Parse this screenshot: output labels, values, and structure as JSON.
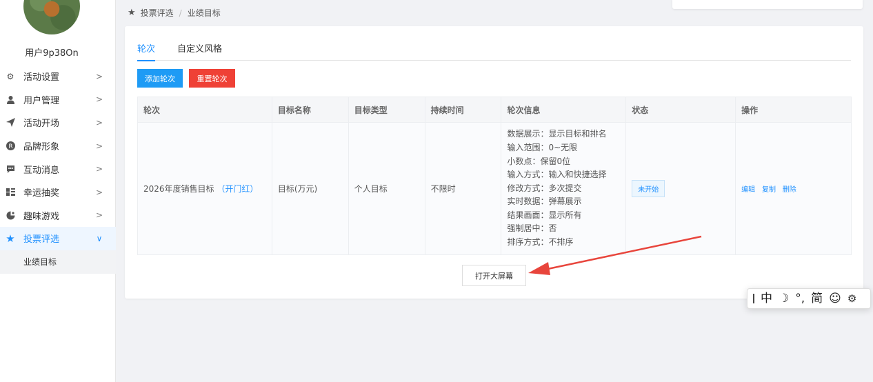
{
  "sidebar": {
    "username": "用户9p38On",
    "items": [
      {
        "label": "活动设置",
        "icon": "settings-gear-icon",
        "arrow": ">"
      },
      {
        "label": "用户管理",
        "icon": "user-icon",
        "arrow": ">"
      },
      {
        "label": "活动开场",
        "icon": "send-icon",
        "arrow": ">"
      },
      {
        "label": "品牌形象",
        "icon": "registered-icon",
        "arrow": ">"
      },
      {
        "label": "互动消息",
        "icon": "chat-icon",
        "arrow": ">"
      },
      {
        "label": "幸运抽奖",
        "icon": "lottery-icon",
        "arrow": ">"
      },
      {
        "label": "趣味游戏",
        "icon": "game-icon",
        "arrow": ">"
      },
      {
        "label": "投票评选",
        "icon": "star-icon",
        "arrow": "∨"
      }
    ],
    "subitem": "业绩目标"
  },
  "breadcrumb": {
    "parent": "投票评选",
    "separator": "/",
    "current": "业绩目标"
  },
  "tabs": [
    "轮次",
    "自定义风格"
  ],
  "buttons": {
    "add": "添加轮次",
    "reset": "重置轮次",
    "open_screen": "打开大屏幕"
  },
  "table": {
    "headers": [
      "轮次",
      "目标名称",
      "目标类型",
      "持续时间",
      "轮次信息",
      "状态",
      "操作"
    ],
    "row": {
      "round": "2026年度销售目标",
      "round_tag": "（开门红）",
      "target_name": "目标(万元)",
      "target_type": "个人目标",
      "duration": "不限时",
      "info": [
        "数据展示：显示目标和排名",
        "输入范围：0~无限",
        "小数点：保留0位",
        "输入方式：输入和快捷选择",
        "修改方式：多次提交",
        "实时数据：弹幕展示",
        "结果画面：显示所有",
        "强制居中：否",
        "排序方式：不排序"
      ],
      "status": "未开始",
      "ops": [
        "编辑",
        "复制",
        "删除"
      ]
    }
  },
  "ime": {
    "mode": "中",
    "moon": "☽",
    "punct": "°,",
    "charset": "简",
    "emoji": "☺",
    "settings": "⚙"
  },
  "colors": {
    "primary": "#1e9bf5",
    "danger": "#ef4136",
    "annotation_arrow": "#e8453c"
  }
}
